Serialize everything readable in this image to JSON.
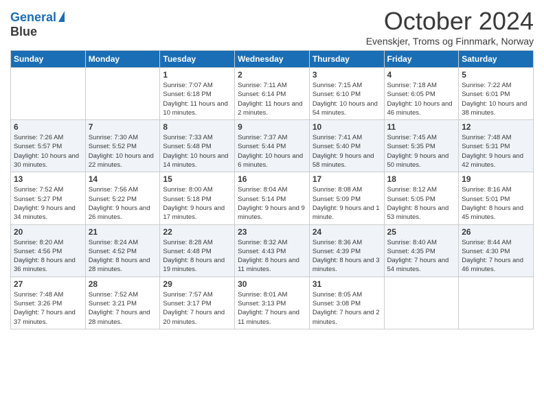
{
  "header": {
    "logo_line1": "General",
    "logo_line2": "Blue",
    "month_title": "October 2024",
    "location": "Evenskjer, Troms og Finnmark, Norway"
  },
  "weekdays": [
    "Sunday",
    "Monday",
    "Tuesday",
    "Wednesday",
    "Thursday",
    "Friday",
    "Saturday"
  ],
  "weeks": [
    [
      {
        "day": "",
        "sunrise": "",
        "sunset": "",
        "daylight": ""
      },
      {
        "day": "",
        "sunrise": "",
        "sunset": "",
        "daylight": ""
      },
      {
        "day": "1",
        "sunrise": "Sunrise: 7:07 AM",
        "sunset": "Sunset: 6:18 PM",
        "daylight": "Daylight: 11 hours and 10 minutes."
      },
      {
        "day": "2",
        "sunrise": "Sunrise: 7:11 AM",
        "sunset": "Sunset: 6:14 PM",
        "daylight": "Daylight: 11 hours and 2 minutes."
      },
      {
        "day": "3",
        "sunrise": "Sunrise: 7:15 AM",
        "sunset": "Sunset: 6:10 PM",
        "daylight": "Daylight: 10 hours and 54 minutes."
      },
      {
        "day": "4",
        "sunrise": "Sunrise: 7:18 AM",
        "sunset": "Sunset: 6:05 PM",
        "daylight": "Daylight: 10 hours and 46 minutes."
      },
      {
        "day": "5",
        "sunrise": "Sunrise: 7:22 AM",
        "sunset": "Sunset: 6:01 PM",
        "daylight": "Daylight: 10 hours and 38 minutes."
      }
    ],
    [
      {
        "day": "6",
        "sunrise": "Sunrise: 7:26 AM",
        "sunset": "Sunset: 5:57 PM",
        "daylight": "Daylight: 10 hours and 30 minutes."
      },
      {
        "day": "7",
        "sunrise": "Sunrise: 7:30 AM",
        "sunset": "Sunset: 5:52 PM",
        "daylight": "Daylight: 10 hours and 22 minutes."
      },
      {
        "day": "8",
        "sunrise": "Sunrise: 7:33 AM",
        "sunset": "Sunset: 5:48 PM",
        "daylight": "Daylight: 10 hours and 14 minutes."
      },
      {
        "day": "9",
        "sunrise": "Sunrise: 7:37 AM",
        "sunset": "Sunset: 5:44 PM",
        "daylight": "Daylight: 10 hours and 6 minutes."
      },
      {
        "day": "10",
        "sunrise": "Sunrise: 7:41 AM",
        "sunset": "Sunset: 5:40 PM",
        "daylight": "Daylight: 9 hours and 58 minutes."
      },
      {
        "day": "11",
        "sunrise": "Sunrise: 7:45 AM",
        "sunset": "Sunset: 5:35 PM",
        "daylight": "Daylight: 9 hours and 50 minutes."
      },
      {
        "day": "12",
        "sunrise": "Sunrise: 7:48 AM",
        "sunset": "Sunset: 5:31 PM",
        "daylight": "Daylight: 9 hours and 42 minutes."
      }
    ],
    [
      {
        "day": "13",
        "sunrise": "Sunrise: 7:52 AM",
        "sunset": "Sunset: 5:27 PM",
        "daylight": "Daylight: 9 hours and 34 minutes."
      },
      {
        "day": "14",
        "sunrise": "Sunrise: 7:56 AM",
        "sunset": "Sunset: 5:22 PM",
        "daylight": "Daylight: 9 hours and 26 minutes."
      },
      {
        "day": "15",
        "sunrise": "Sunrise: 8:00 AM",
        "sunset": "Sunset: 5:18 PM",
        "daylight": "Daylight: 9 hours and 17 minutes."
      },
      {
        "day": "16",
        "sunrise": "Sunrise: 8:04 AM",
        "sunset": "Sunset: 5:14 PM",
        "daylight": "Daylight: 9 hours and 9 minutes."
      },
      {
        "day": "17",
        "sunrise": "Sunrise: 8:08 AM",
        "sunset": "Sunset: 5:09 PM",
        "daylight": "Daylight: 9 hours and 1 minute."
      },
      {
        "day": "18",
        "sunrise": "Sunrise: 8:12 AM",
        "sunset": "Sunset: 5:05 PM",
        "daylight": "Daylight: 8 hours and 53 minutes."
      },
      {
        "day": "19",
        "sunrise": "Sunrise: 8:16 AM",
        "sunset": "Sunset: 5:01 PM",
        "daylight": "Daylight: 8 hours and 45 minutes."
      }
    ],
    [
      {
        "day": "20",
        "sunrise": "Sunrise: 8:20 AM",
        "sunset": "Sunset: 4:56 PM",
        "daylight": "Daylight: 8 hours and 36 minutes."
      },
      {
        "day": "21",
        "sunrise": "Sunrise: 8:24 AM",
        "sunset": "Sunset: 4:52 PM",
        "daylight": "Daylight: 8 hours and 28 minutes."
      },
      {
        "day": "22",
        "sunrise": "Sunrise: 8:28 AM",
        "sunset": "Sunset: 4:48 PM",
        "daylight": "Daylight: 8 hours and 19 minutes."
      },
      {
        "day": "23",
        "sunrise": "Sunrise: 8:32 AM",
        "sunset": "Sunset: 4:43 PM",
        "daylight": "Daylight: 8 hours and 11 minutes."
      },
      {
        "day": "24",
        "sunrise": "Sunrise: 8:36 AM",
        "sunset": "Sunset: 4:39 PM",
        "daylight": "Daylight: 8 hours and 3 minutes."
      },
      {
        "day": "25",
        "sunrise": "Sunrise: 8:40 AM",
        "sunset": "Sunset: 4:35 PM",
        "daylight": "Daylight: 7 hours and 54 minutes."
      },
      {
        "day": "26",
        "sunrise": "Sunrise: 8:44 AM",
        "sunset": "Sunset: 4:30 PM",
        "daylight": "Daylight: 7 hours and 46 minutes."
      }
    ],
    [
      {
        "day": "27",
        "sunrise": "Sunrise: 7:48 AM",
        "sunset": "Sunset: 3:26 PM",
        "daylight": "Daylight: 7 hours and 37 minutes."
      },
      {
        "day": "28",
        "sunrise": "Sunrise: 7:52 AM",
        "sunset": "Sunset: 3:21 PM",
        "daylight": "Daylight: 7 hours and 28 minutes."
      },
      {
        "day": "29",
        "sunrise": "Sunrise: 7:57 AM",
        "sunset": "Sunset: 3:17 PM",
        "daylight": "Daylight: 7 hours and 20 minutes."
      },
      {
        "day": "30",
        "sunrise": "Sunrise: 8:01 AM",
        "sunset": "Sunset: 3:13 PM",
        "daylight": "Daylight: 7 hours and 11 minutes."
      },
      {
        "day": "31",
        "sunrise": "Sunrise: 8:05 AM",
        "sunset": "Sunset: 3:08 PM",
        "daylight": "Daylight: 7 hours and 2 minutes."
      },
      {
        "day": "",
        "sunrise": "",
        "sunset": "",
        "daylight": ""
      },
      {
        "day": "",
        "sunrise": "",
        "sunset": "",
        "daylight": ""
      }
    ]
  ]
}
